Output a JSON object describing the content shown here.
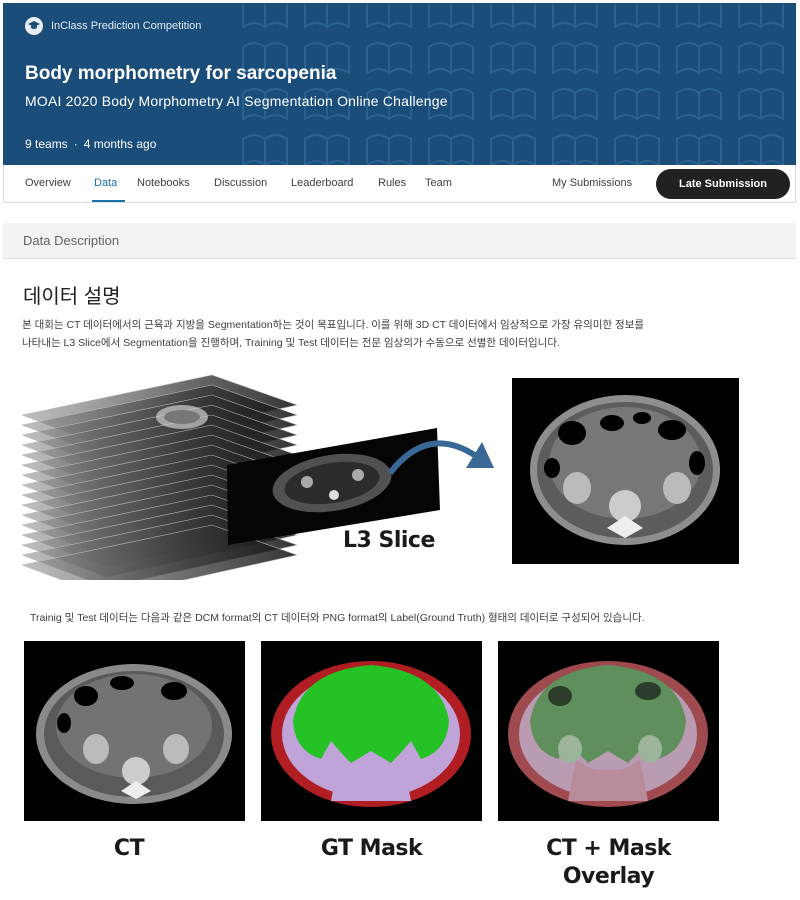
{
  "banner": {
    "competition_type": "InClass Prediction Competition",
    "title": "Body morphometry for sarcopenia",
    "subtitle": "MOAI 2020 Body Morphometry AI Segmentation Online Challenge",
    "teams": "9 teams",
    "separator": "·",
    "age": "4 months ago",
    "background_color": "#1b4d7a",
    "icon": "graduation-cap-icon"
  },
  "tabs": {
    "items": [
      "Overview",
      "Data",
      "Notebooks",
      "Discussion",
      "Leaderboard",
      "Rules",
      "Team"
    ],
    "active": "Data",
    "my_submissions": "My Submissions",
    "late_submission": "Late Submission"
  },
  "data_section": {
    "header": "Data Description",
    "title": "데이터 설명",
    "paragraph1_line1": " 본 대회는 CT 데이터에서의 근육과 지방을 Segmentation하는 것이 목표입니다. 이를 위해 3D CT 데이터에서 임상적으로 가장 유의미한 정보를",
    "paragraph1_line2": "나타내는 L3 Slice에서 Segmentation을 진행하며, Training 및 Test 데이터는 전문 임상의가 수동으로 선별한 데이터입니다.",
    "figure1_label": "L3 Slice",
    "paragraph2": "Trainig 및 Test 데이터는 다음과 같은 DCM format의 CT 데이터와 PNG format의 Label(Ground Truth) 형태의 데이터로 구성되어 있습니다.",
    "captions": {
      "ct": "CT",
      "gt_mask": "GT Mask",
      "overlay_line1": "CT + Mask",
      "overlay_line2": "Overlay"
    }
  },
  "colors": {
    "tab_active": "#1a73a8",
    "late_button": "#202124",
    "mask_fat": "#b01e23",
    "mask_muscle": "#c0a3d9",
    "mask_visceral": "#24c224"
  }
}
